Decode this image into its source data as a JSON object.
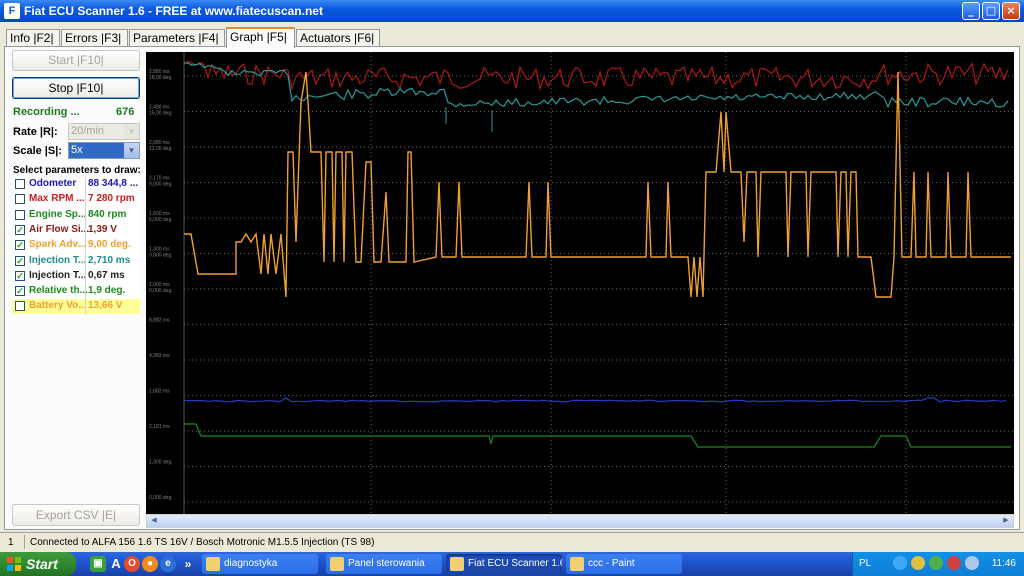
{
  "window": {
    "title": "Fiat ECU Scanner 1.6 - FREE at www.fiatecuscan.net",
    "controls": [
      "_",
      "□",
      "×"
    ]
  },
  "tabs": [
    {
      "label": "Info |F2|",
      "active": false
    },
    {
      "label": "Errors |F3|",
      "active": false
    },
    {
      "label": "Parameters |F4|",
      "active": false
    },
    {
      "label": "Graph |F5|",
      "active": true
    },
    {
      "label": "Actuators |F6|",
      "active": false
    }
  ],
  "controls": {
    "start_label": "Start |F10|",
    "stop_label": "Stop |F10|",
    "recording_label": "Recording ...",
    "recording_count": "676",
    "rate_label": "Rate |R|:",
    "rate_value": "20/min",
    "scale_label": "Scale |S|:",
    "scale_value": "5x",
    "select_label": "Select parameters to draw:",
    "export_label": "Export CSV |E|"
  },
  "parameters": [
    {
      "name": "Odometer",
      "value": "88 344,8 ...",
      "checked": false,
      "color": "#1a1ab4",
      "bg": "#ffffff"
    },
    {
      "name": "Max RPM ...",
      "value": "7 280 rpm",
      "checked": false,
      "color": "#c81e1e",
      "bg": "#ffffff"
    },
    {
      "name": "Engine Sp...",
      "value": "840 rpm",
      "checked": false,
      "color": "#1c8a1c",
      "bg": "#ffffff"
    },
    {
      "name": "Air Flow Si...",
      "value": "1,39 V",
      "checked": true,
      "color": "#8b1a1a",
      "bg": "#ffffff"
    },
    {
      "name": "Spark Adv...",
      "value": "9,00 deg.",
      "checked": true,
      "color": "#f0a030",
      "bg": "#ffffff"
    },
    {
      "name": "Injection T...",
      "value": "2,710 ms",
      "checked": true,
      "color": "#1e8c8c",
      "bg": "#ffffff"
    },
    {
      "name": "Injection T...",
      "value": "0,67 ms",
      "checked": true,
      "color": "#222222",
      "bg": "#ffffff"
    },
    {
      "name": "Relative th...",
      "value": "1,9 deg.",
      "checked": true,
      "color": "#1c8a1c",
      "bg": "#ffffff"
    },
    {
      "name": "Battery Vo...",
      "value": "13,66 V",
      "checked": false,
      "color": "#f0a030",
      "bg": "#ffff99"
    }
  ],
  "graph": {
    "left_labels": [
      {
        "a": "2,880 ms",
        "b": "18,00 deg."
      },
      {
        "a": "2,480 ms",
        "b": "15,00 deg."
      },
      {
        "a": "2,080 ms",
        "b": "12,00 deg."
      },
      {
        "a": "2,170 ms",
        "b": "9,000 deg."
      },
      {
        "a": "1,600 ms",
        "b": "6,000 deg."
      },
      {
        "a": "1,300 ms",
        "b": "3,000 deg."
      },
      {
        "a": "1,000 ms",
        "b": "0,000 deg."
      },
      {
        "a": "8,882 ms",
        "b": ""
      },
      {
        "a": "4,982 ms",
        "b": ""
      },
      {
        "a": "1,682 ms",
        "b": ""
      },
      {
        "a": "2,181 ms",
        "b": ""
      },
      {
        "a": "1,300 deg.",
        "b": ""
      },
      {
        "a": "0,000 deg.",
        "b": ""
      }
    ]
  },
  "status": {
    "cell1": "1",
    "text": "Connected to ALFA 156 1.6 TS 16V / Bosch Motronic M1.5.5 Injection (TS 98)"
  },
  "taskbar": {
    "start_label": "Start",
    "tasks": [
      {
        "label": "diagnostyka",
        "active": false
      },
      {
        "label": "Panel sterowania",
        "active": false
      },
      {
        "label": "Fiat ECU Scanner 1.6...",
        "active": true
      },
      {
        "label": "ccc - Paint",
        "active": false
      }
    ],
    "lang": "PL",
    "clock": "11:46"
  }
}
